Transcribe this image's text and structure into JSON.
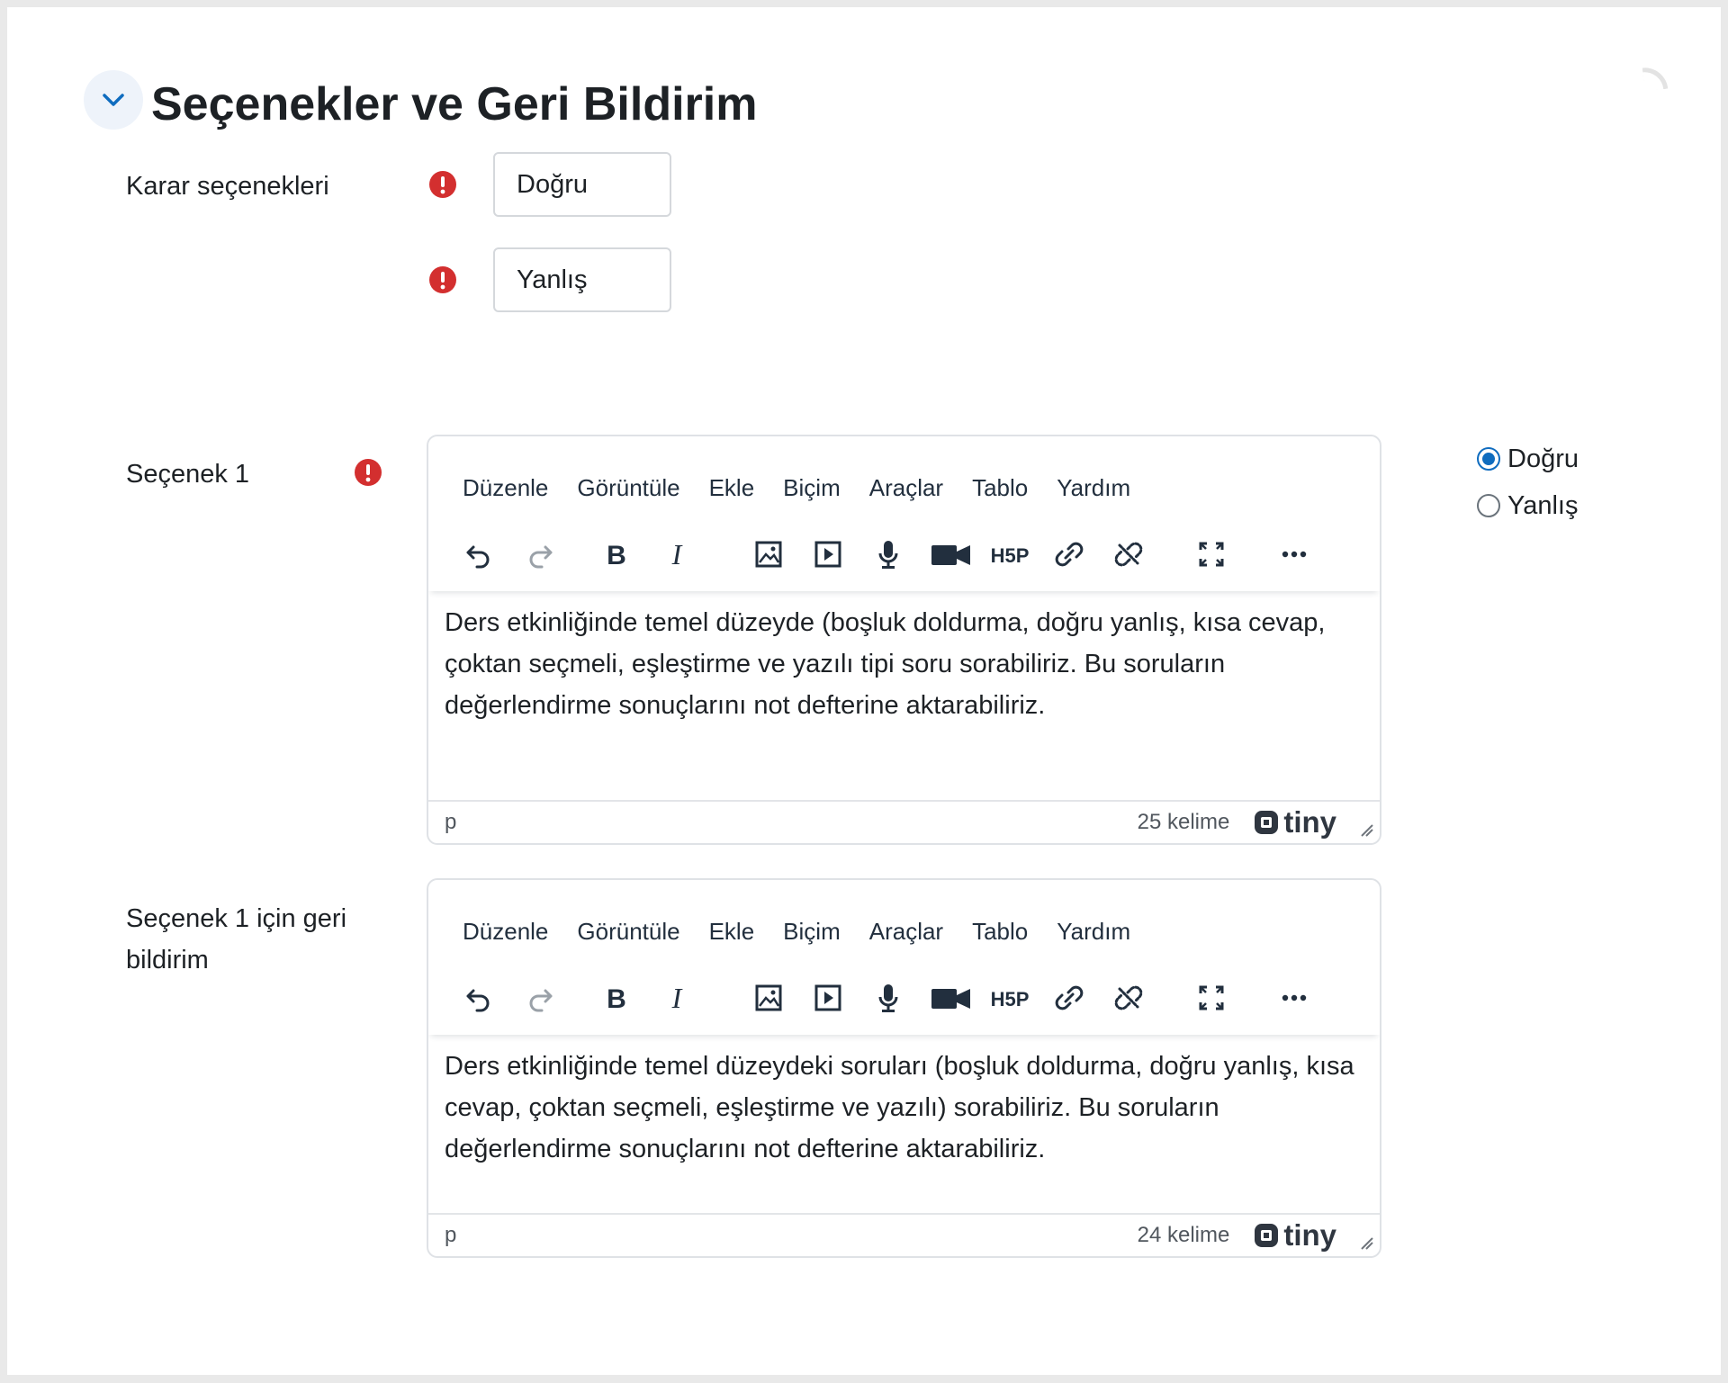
{
  "section": {
    "title": "Seçenekler ve Geri Bildirim"
  },
  "decision_options": {
    "label": "Karar seçenekleri",
    "option_true": "Doğru",
    "option_false": "Yanlış"
  },
  "editor_menu": [
    "Düzenle",
    "Görüntüle",
    "Ekle",
    "Biçim",
    "Araçlar",
    "Tablo",
    "Yardım"
  ],
  "toolbar_icons": [
    "undo-icon",
    "redo-icon",
    "bold-icon",
    "italic-icon",
    "image-icon",
    "media-icon",
    "microphone-icon",
    "video-camera-icon",
    "h5p-icon",
    "link-icon",
    "unlink-icon",
    "fullscreen-icon",
    "more-icon"
  ],
  "choice1": {
    "label": "Seçenek 1",
    "text": "Ders etkinliğinde temel düzeyde (boşluk doldurma, doğru yanlış, kısa cevap, çoktan seçmeli, eşleştirme ve yazılı tipi soru sorabiliriz. Bu soruların değerlendirme sonuçlarını not defterine aktarabiliriz.",
    "path": "p",
    "wordcount": "25 kelime",
    "answer": {
      "options": [
        "Doğru",
        "Yanlış"
      ],
      "selected": "Doğru"
    }
  },
  "feedback1": {
    "label": "Seçenek 1 için geri bildirim",
    "text": "Ders etkinliğinde temel düzeydeki soruları (boşluk doldurma, doğru yanlış, kısa cevap, çoktan seçmeli, eşleştirme ve yazılı) sorabiliriz. Bu soruların değerlendirme sonuçlarını not defterine aktarabiliriz.",
    "path": "p",
    "wordcount": "24 kelime"
  },
  "brand": "tiny",
  "colors": {
    "accent": "#0f6cbf",
    "error": "#ca3120",
    "text": "#1d2125"
  }
}
